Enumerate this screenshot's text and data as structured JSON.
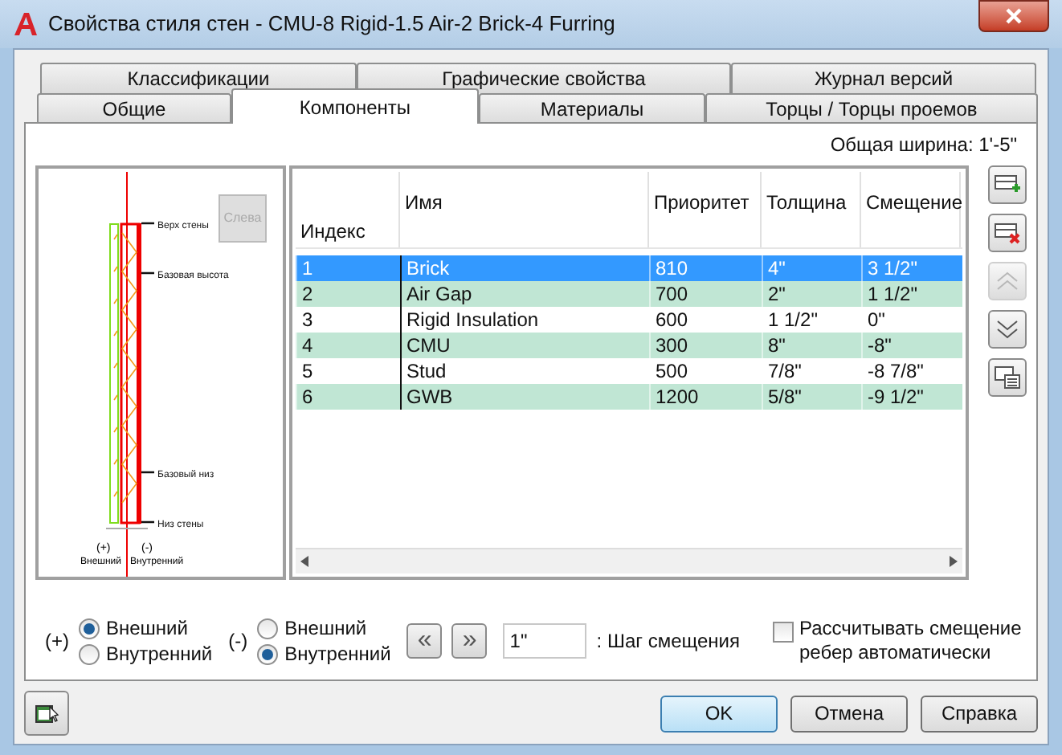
{
  "window": {
    "title": "Свойства стиля стен - CMU-8 Rigid-1.5 Air-2 Brick-4 Furring"
  },
  "tabs_back": [
    {
      "label": "Классификации",
      "selected": false
    },
    {
      "label": "Графические свойства",
      "selected": false
    },
    {
      "label": "Журнал версий",
      "selected": false
    }
  ],
  "tabs_front": [
    {
      "label": "Общие",
      "selected": false
    },
    {
      "label": "Компоненты",
      "selected": true
    },
    {
      "label": "Материалы",
      "selected": false
    },
    {
      "label": "Торцы / Торцы проемов",
      "selected": false
    }
  ],
  "total_width": "Общая ширина: 1'-5\"",
  "preview": {
    "view_button": "Слева",
    "labels": [
      "Верх стены",
      "Базовая высота",
      "Базовый низ",
      "Низ стены"
    ],
    "exterior_sign": "(+)",
    "exterior": "Внешний",
    "interior_sign": "(-)",
    "interior": "Внутренний"
  },
  "table": {
    "columns": [
      "Индекс",
      "Имя",
      "Приоритет",
      "Толщина",
      "Смещение"
    ],
    "rows": [
      {
        "cells": [
          "1",
          "Brick",
          "810",
          "4\"",
          "3 1/2\""
        ],
        "selected": true
      },
      {
        "cells": [
          "2",
          "Air Gap",
          "700",
          "2\"",
          "1 1/2\""
        ],
        "selected": false
      },
      {
        "cells": [
          "3",
          "Rigid Insulation",
          "600",
          "1 1/2\"",
          "0\""
        ],
        "selected": false
      },
      {
        "cells": [
          "4",
          "CMU",
          "300",
          "8\"",
          "-8\""
        ],
        "selected": false
      },
      {
        "cells": [
          "5",
          "Stud",
          "500",
          "7/8\"",
          "-8 7/8\""
        ],
        "selected": false
      },
      {
        "cells": [
          "6",
          "GWB",
          "1200",
          "5/8\"",
          "-9 1/2\""
        ],
        "selected": false
      }
    ]
  },
  "side_buttons": [
    {
      "kind": "add",
      "disabled": false
    },
    {
      "kind": "delete",
      "disabled": false
    },
    {
      "kind": "up",
      "disabled": true
    },
    {
      "kind": "down",
      "disabled": false
    },
    {
      "kind": "details",
      "disabled": false
    }
  ],
  "radio_groups": [
    {
      "sign": "(+)",
      "options": [
        {
          "label": "Внешний",
          "selected": true
        },
        {
          "label": "Внутренний",
          "selected": false
        }
      ]
    },
    {
      "sign": "(-)",
      "options": [
        {
          "label": "Внешний",
          "selected": false
        },
        {
          "label": "Внутренний",
          "selected": true
        }
      ]
    }
  ],
  "shift_buttons": [
    {
      "label": "«"
    },
    {
      "label": "»"
    }
  ],
  "step": {
    "value": "1\"",
    "label": ": Шаг смещения"
  },
  "auto_offset": {
    "label": "Рассчитывать смещение ребер автоматически",
    "checked": false
  },
  "buttons": [
    {
      "label": "OK",
      "default": true
    },
    {
      "label": "Отмена",
      "default": false
    },
    {
      "label": "Справка",
      "default": false
    }
  ]
}
